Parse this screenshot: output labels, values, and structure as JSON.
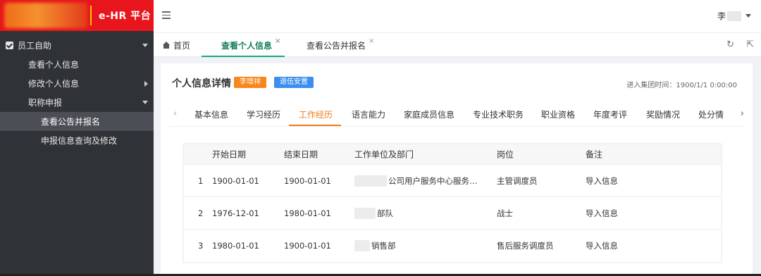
{
  "brand": {
    "logo_text": "e-HR 平台"
  },
  "sidebar": {
    "group_label": "员工自助",
    "items": [
      {
        "label": "查看个人信息"
      },
      {
        "label": "修改个人信息"
      },
      {
        "label": "职称申报"
      }
    ],
    "subitems": [
      {
        "label": "查看公告并报名",
        "active": true
      },
      {
        "label": "申报信息查询及修改",
        "active": false
      }
    ]
  },
  "header": {
    "user_name": "李"
  },
  "tabs": [
    {
      "label": "首页"
    },
    {
      "label": "查看个人信息",
      "active": true,
      "close": "×"
    },
    {
      "label": "查看公告并报名",
      "close": "×"
    }
  ],
  "tool_icons": {
    "refresh": "↻",
    "popout": "⇱"
  },
  "detail": {
    "title": "个人信息详情",
    "badge_name": "李增祥",
    "badge_status": "退伍安置",
    "join_time_label": "进入集团时间：1900/1/1 0:00:00"
  },
  "subtabs": [
    {
      "label": "基本信息"
    },
    {
      "label": "学习经历"
    },
    {
      "label": "工作经历",
      "active": true
    },
    {
      "label": "语言能力"
    },
    {
      "label": "家庭成员信息"
    },
    {
      "label": "专业技术职务"
    },
    {
      "label": "职业资格"
    },
    {
      "label": "年度考评"
    },
    {
      "label": "奖励情况"
    },
    {
      "label": "处分情"
    }
  ],
  "table": {
    "headers": {
      "start": "开始日期",
      "end": "结束日期",
      "unit": "工作单位及部门",
      "post": "岗位",
      "note": "备注"
    },
    "rows": [
      {
        "idx": "1",
        "start": "1900-01-01",
        "end": "1900-01-01",
        "unit": "公司用户服务中心服务…",
        "post": "主管调度员",
        "note": "导入信息"
      },
      {
        "idx": "2",
        "start": "1976-12-01",
        "end": "1980-01-01",
        "unit": "部队",
        "post": "战士",
        "note": "导入信息"
      },
      {
        "idx": "3",
        "start": "1980-01-01",
        "end": "1900-01-01",
        "unit": "销售部",
        "post": "售后服务调度员",
        "note": "导入信息"
      }
    ]
  },
  "colors": {
    "brand_red": "#e8161c",
    "accent_green": "#13a97b",
    "accent_orange": "#f07c1d",
    "badge_blue": "#3c8ef0",
    "sidebar_bg": "#2f3237"
  }
}
